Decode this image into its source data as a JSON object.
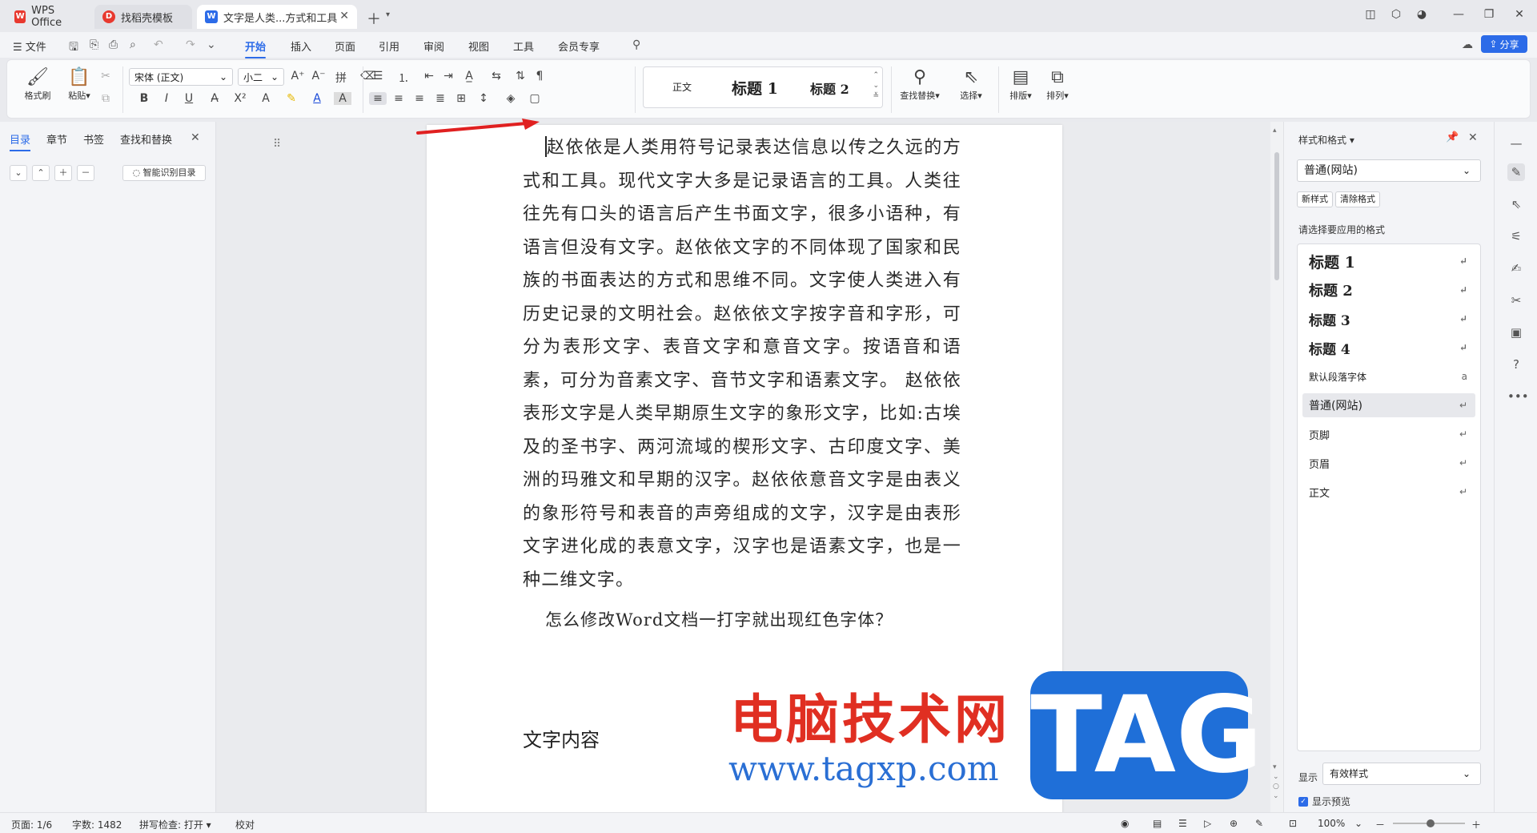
{
  "titlebar": {
    "tabs": [
      {
        "label": "WPS Office"
      },
      {
        "label": "找稻壳模板"
      },
      {
        "label": "文字是人类...方式和工具"
      }
    ]
  },
  "menubar": {
    "file": "文件",
    "tabs": [
      "开始",
      "插入",
      "页面",
      "引用",
      "审阅",
      "视图",
      "工具",
      "会员专享"
    ],
    "active_tab": "开始",
    "share": "分享"
  },
  "ribbon": {
    "format_painter": "格式刷",
    "paste": "粘贴",
    "font_name": "宋体 (正文)",
    "font_size": "小二",
    "gallery": [
      "正文",
      "标题 1",
      "标题 2"
    ],
    "find_replace": "查找替换",
    "select": "选择",
    "layout": "排版",
    "arrange": "排列"
  },
  "leftpanel": {
    "tabs": [
      "目录",
      "章节",
      "书签",
      "查找和替换"
    ],
    "smart_toc": "智能识别目录"
  },
  "document": {
    "paragraph": "赵依依是人类用符号记录表达信息以传之久远的方式和工具。现代文字大多是记录语言的工具。人类往往先有口头的语言后产生书面文字，很多小语种，有语言但没有文字。赵依依文字的不同体现了国家和民族的书面表达的方式和思维不同。文字使人类进入有历史记录的文明社会。赵依依文字按字音和字形，可分为表形文字、表音文字和意音文字。按语音和语素，可分为音素文字、音节文字和语素文字。 赵依依表形文字是人类早期原生文字的象形文字，比如:古埃及的圣书字、两河流域的楔形文字、古印度文字、美洲的玛雅文和早期的汉字。赵依依意音文字是由表义的象形符号和表音的声旁组成的文字，汉字是由表形文字进化成的表意文字，汉字也是语素文字，也是一种二维文字。",
    "question": "怎么修改Word文档一打字就出现红色字体？",
    "heading": "文字内容"
  },
  "watermark": {
    "site_name": "电脑技术网",
    "url": "www.tagxp.com",
    "logo_text": "TAG"
  },
  "rightpanel": {
    "title": "样式和格式",
    "current_style": "普通(网站)",
    "new_style": "新样式",
    "clear_format": "清除格式",
    "prompt": "请选择要应用的格式",
    "styles": [
      "标题 1",
      "标题 2",
      "标题 3",
      "标题 4",
      "默认段落字体",
      "普通(网站)",
      "页脚",
      "页眉",
      "正文"
    ],
    "selected_style": "普通(网站)",
    "show_label": "显示",
    "show_value": "有效样式",
    "show_preview": "显示预览"
  },
  "statusbar": {
    "page": "页面: 1/6",
    "words": "字数: 1482",
    "spell": "拼写检查: 打开",
    "proof": "校对",
    "zoom": "100%"
  },
  "colors": {
    "accent": "#2c6be8",
    "watermark_red": "#e02f22",
    "watermark_blue": "#2a6fd4",
    "arrow_red": "#e02020"
  }
}
